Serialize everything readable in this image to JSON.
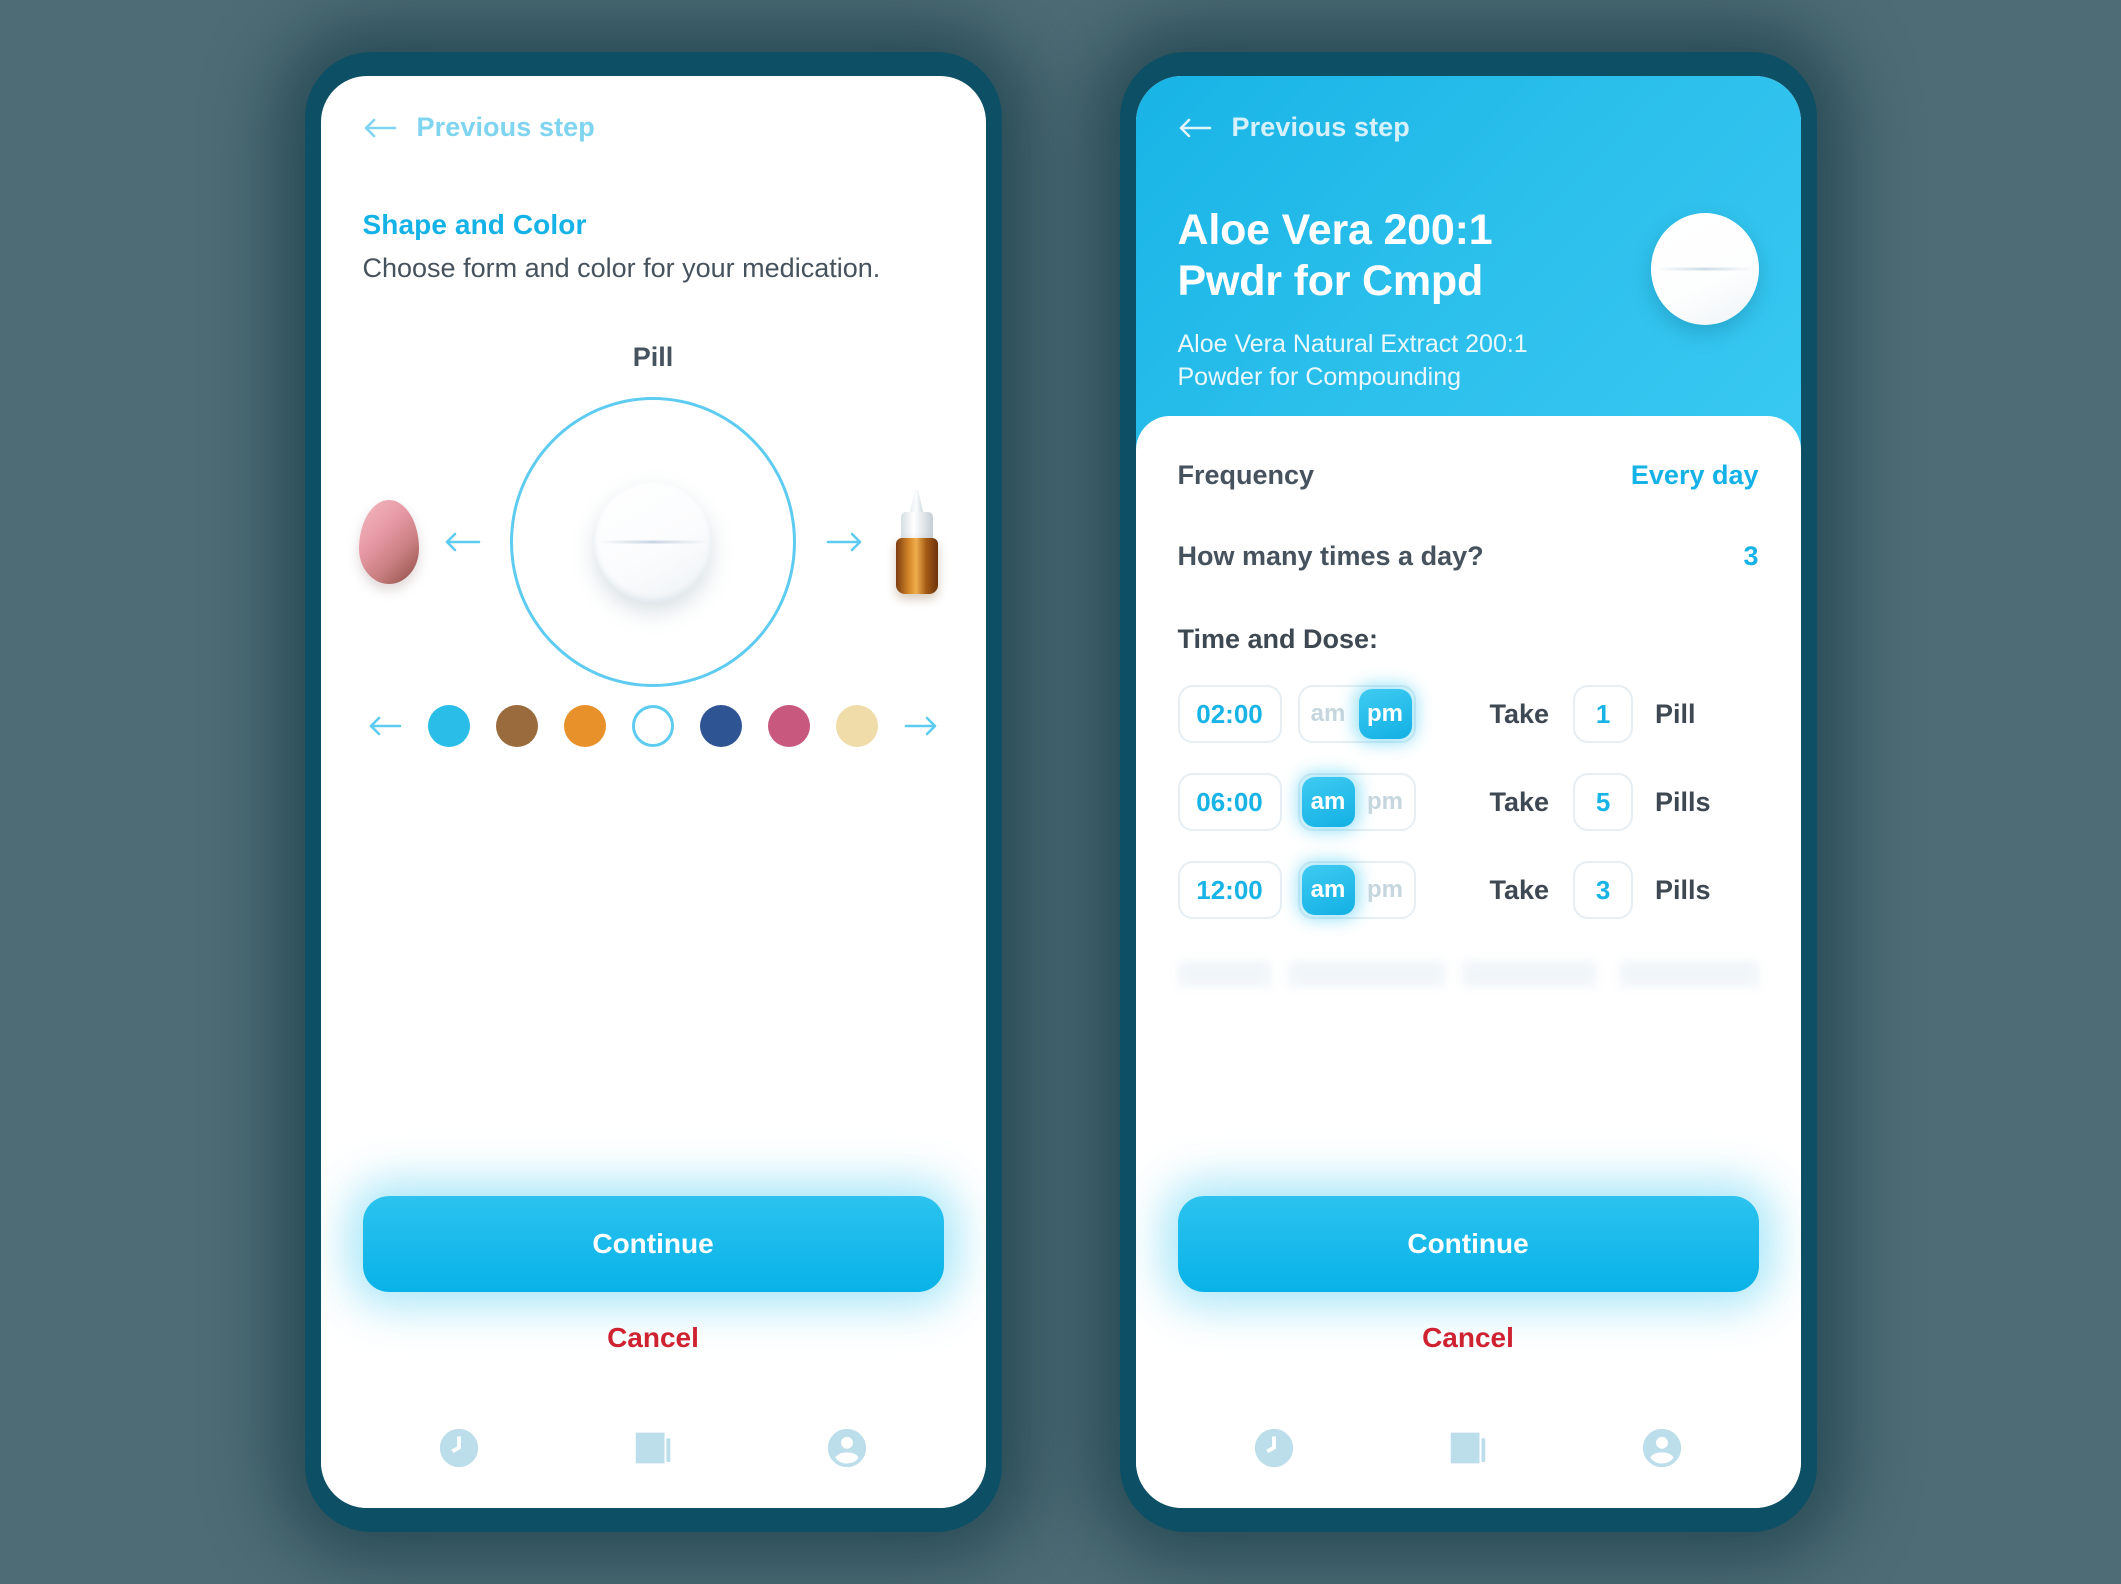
{
  "theme": {
    "accent": "#14b2e6",
    "accent_light": "#5ecbf0",
    "danger": "#cf2230",
    "text_dark": "#46525d",
    "frame": "#0d4f64",
    "background": "#4d6c75"
  },
  "left_phone": {
    "topbar": {
      "back_label": "Previous step",
      "back_icon": "arrow-left-icon"
    },
    "section": {
      "title": "Shape and Color",
      "subtitle": "Choose form and color for your medication."
    },
    "form": {
      "selected_form_label": "Pill",
      "prev_form_icon": "pink-egg-capsule-icon",
      "next_form_icon": "nasal-spray-bottle-icon",
      "prev_arrow_icon": "arrow-left-icon",
      "next_arrow_icon": "arrow-right-icon",
      "center_icon": "white-scored-pill-icon"
    },
    "colors": {
      "prev_arrow_icon": "arrow-left-icon",
      "next_arrow_icon": "arrow-right-icon",
      "swatches": [
        {
          "name": "cyan",
          "hex": "#29bde8",
          "selected": false
        },
        {
          "name": "brown",
          "hex": "#9a6b3c",
          "selected": false
        },
        {
          "name": "orange",
          "hex": "#e8912b",
          "selected": false
        },
        {
          "name": "white",
          "hex": "#ffffff",
          "selected": true
        },
        {
          "name": "navy",
          "hex": "#2f5494",
          "selected": false
        },
        {
          "name": "pink",
          "hex": "#c8587e",
          "selected": false
        },
        {
          "name": "cream",
          "hex": "#f0dca8",
          "selected": false
        }
      ]
    },
    "footer": {
      "continue_label": "Continue",
      "cancel_label": "Cancel"
    },
    "navbar": [
      {
        "name": "clock-icon",
        "label": "History"
      },
      {
        "name": "journal-icon",
        "label": "Journal"
      },
      {
        "name": "profile-icon",
        "label": "Profile"
      }
    ]
  },
  "right_phone": {
    "topbar": {
      "back_label": "Previous step",
      "back_icon": "arrow-left-icon"
    },
    "header": {
      "med_name": "Aloe Vera 200:1 Pwdr for Cmpd",
      "med_description": "Aloe Vera Natural Extract 200:1 Powder for Compounding",
      "med_icon": "white-scored-pill-icon"
    },
    "settings": [
      {
        "label": "Frequency",
        "value": "Every day"
      },
      {
        "label": "How many times a day?",
        "value": "3"
      }
    ],
    "time_and_dose": {
      "title": "Time and Dose:",
      "take_label": "Take",
      "meridiem_options": [
        "am",
        "pm"
      ],
      "rows": [
        {
          "time": "02:00",
          "meridiem": "pm",
          "count": "1",
          "unit": "Pill"
        },
        {
          "time": "06:00",
          "meridiem": "am",
          "count": "5",
          "unit": "Pills"
        },
        {
          "time": "12:00",
          "meridiem": "am",
          "count": "3",
          "unit": "Pills"
        }
      ]
    },
    "footer": {
      "continue_label": "Continue",
      "cancel_label": "Cancel"
    },
    "navbar": [
      {
        "name": "clock-icon",
        "label": "History"
      },
      {
        "name": "journal-icon",
        "label": "Journal"
      },
      {
        "name": "profile-icon",
        "label": "Profile"
      }
    ]
  }
}
